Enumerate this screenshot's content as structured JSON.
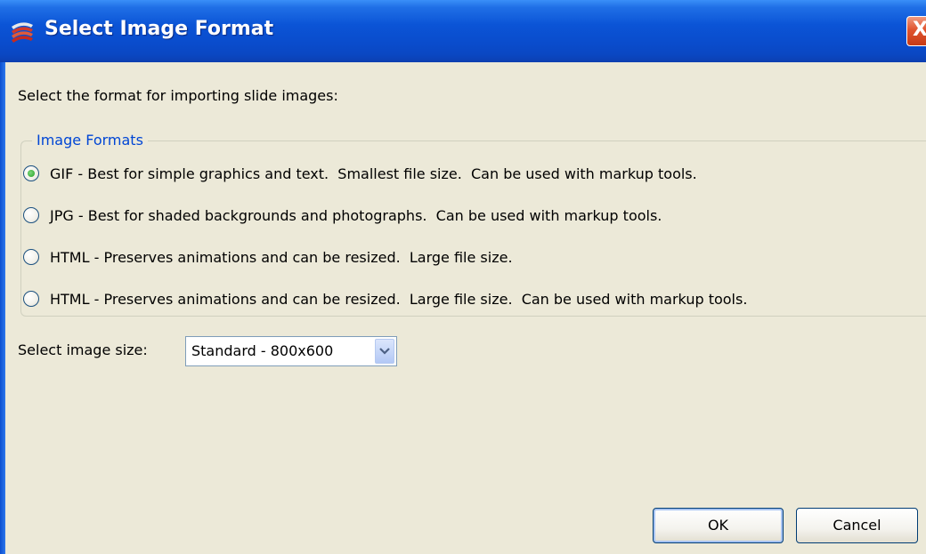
{
  "window": {
    "title": "Select Image Format",
    "close_glyph": "X",
    "title_bar_color": "#0a4ccc"
  },
  "prompt": "Select the format for importing slide images:",
  "group": {
    "legend": "Image Formats",
    "legend_color": "#0046d5",
    "options": [
      {
        "label": "GIF - Best for simple graphics and text.  Smallest file size.  Can be used with markup tools.",
        "checked": true
      },
      {
        "label": "JPG - Best for shaded backgrounds and photographs.  Can be used with markup tools.",
        "checked": false
      },
      {
        "label": "HTML - Preserves animations and can be resized.  Large file size.",
        "checked": false
      },
      {
        "label": "HTML - Preserves animations and can be resized.  Large file size.  Can be used with markup tools.",
        "checked": false
      }
    ]
  },
  "size": {
    "label": "Select image size:",
    "selected": "Standard - 800x600"
  },
  "buttons": {
    "ok": "OK",
    "cancel": "Cancel"
  }
}
